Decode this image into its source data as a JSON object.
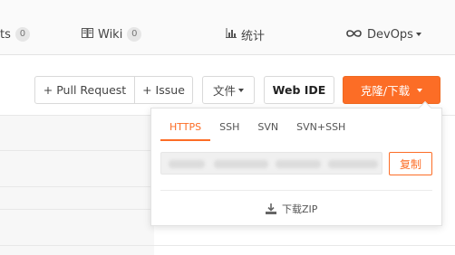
{
  "nav": {
    "items": [
      {
        "label": "ts",
        "count": "0",
        "icon": null
      },
      {
        "label": "Wiki",
        "count": "0",
        "icon": "book-icon"
      },
      {
        "label": "统计",
        "icon": "chart-icon"
      },
      {
        "label": "DevOps",
        "icon": "infinity-icon"
      }
    ]
  },
  "toolbar": {
    "pull_request": "+ Pull Request",
    "issue": "+ Issue",
    "file": "文件",
    "web_ide": "Web IDE",
    "clone": "克隆/下载"
  },
  "dropdown": {
    "tabs": [
      "HTTPS",
      "SSH",
      "SVN",
      "SVN+SSH"
    ],
    "active_tab": "HTTPS",
    "copy_label": "复制",
    "download_zip": "下载ZIP"
  },
  "colors": {
    "accent": "#fc6d26",
    "border": "#d9d9d9"
  }
}
